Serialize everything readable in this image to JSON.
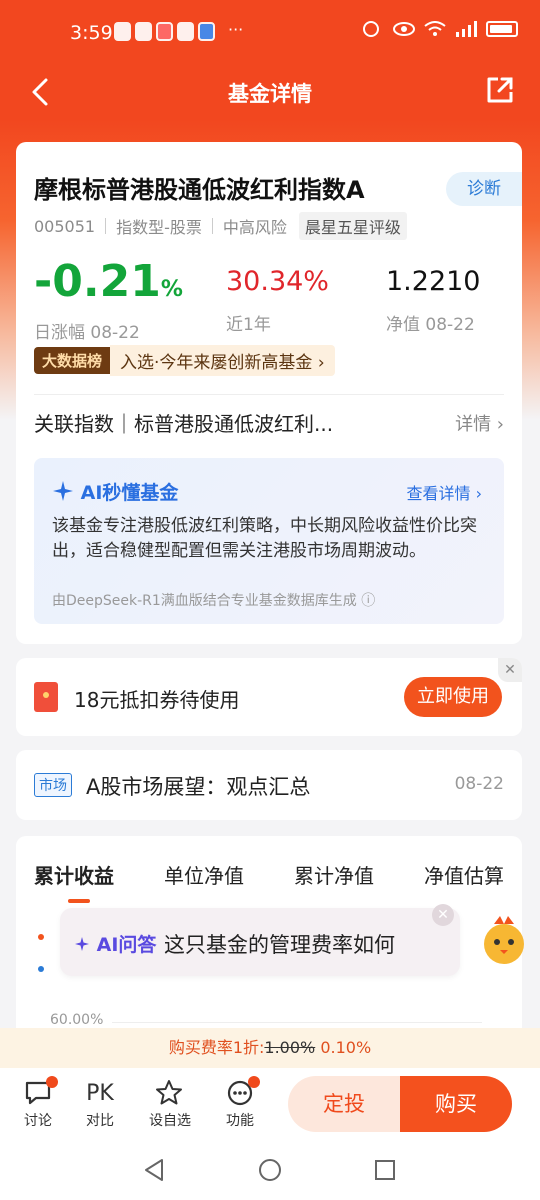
{
  "status": {
    "time": "3:59",
    "more": "···"
  },
  "nav": {
    "title": "基金详情"
  },
  "fund": {
    "name": "摩根标普港股通低波红利指数A",
    "diagnose_label": "诊断",
    "code": "005051",
    "type": "指数型-股票",
    "risk": "中高风险",
    "rating": "晨星五星评级",
    "daily_change": "-0.21",
    "daily_change_unit": "%",
    "daily_change_label": "日涨幅 08-22",
    "year_return": "30.34%",
    "year_return_label": "近1年",
    "nav_value": "1.2210",
    "nav_label": "净值 08-22",
    "big_data_badge": "大数据榜",
    "big_data_text": "入选·今年来屡创新高基金",
    "index_label": "关联指数｜标普港股通低波红利...",
    "index_detail": "详情",
    "colors": {
      "down": "#13a53a",
      "up": "#e0262b"
    }
  },
  "ai": {
    "title": "AI秒懂基金",
    "link": "查看详情",
    "text": "该基金专注港股低波红利策略，中长期风险收益性价比突出，适合稳健型配置但需关注港股市场周期波动。",
    "note": "由DeepSeek-R1满血版结合专业基金数据库生成"
  },
  "coupon": {
    "text": "18元抵扣券待使用",
    "button": "立即使用"
  },
  "news": {
    "tag": "市场",
    "title": "A股市场展望：观点汇总",
    "date": "08-22"
  },
  "chart_tabs": [
    "累计收益",
    "单位净值",
    "累计净值",
    "净值估算"
  ],
  "chart": {
    "y_tick": "60.00%"
  },
  "ai_ask": {
    "label": "AI问答",
    "text": "这只基金的管理费率如何"
  },
  "fee": {
    "prefix": "购买费率1折:",
    "old": "1.00%",
    "new": "0.10%"
  },
  "toolbar": {
    "items": [
      {
        "label": "讨论",
        "icon": "chat-icon"
      },
      {
        "label": "对比",
        "icon": "PK"
      },
      {
        "label": "设自选",
        "icon": "star-add-icon"
      },
      {
        "label": "功能",
        "icon": "more-icon"
      }
    ],
    "dingtou": "定投",
    "buy": "购买"
  }
}
